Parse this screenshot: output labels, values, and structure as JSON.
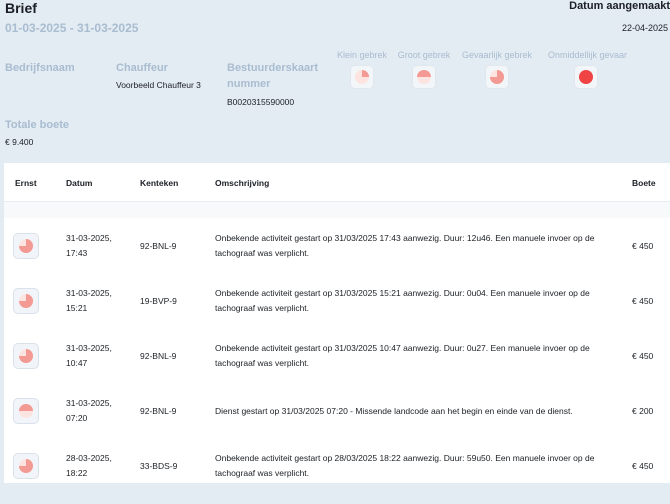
{
  "header": {
    "title": "Brief",
    "period": "01-03-2025 - 31-03-2025",
    "created_label": "Datum aangemaakt",
    "created_date": "22-04-2025"
  },
  "info": {
    "company_label": "Bedrijfsnaam",
    "driver_label": "Chauffeur",
    "driver_value": "Voorbeeld Chauffeur 3",
    "card_label_line1": "Bestuurderskaart",
    "card_label_line2": "nummer",
    "card_value": "B0020315590000",
    "fine_label": "Totale boete",
    "fine_value": "€ 9.400"
  },
  "severity_legend": [
    {
      "label": "Klein gebrek",
      "icon": "pie-quarter-icon"
    },
    {
      "label": "Groot gebrek",
      "icon": "pie-half-icon"
    },
    {
      "label": "Gevaarlijk gebrek",
      "icon": "pie-three-quarter-icon"
    },
    {
      "label": "Onmiddellijk gevaar",
      "icon": "full-circle-icon"
    }
  ],
  "colors": {
    "accent": "#f29a93",
    "danger": "#f04343",
    "muted": "#a9bcd0"
  },
  "table": {
    "headers": {
      "severity": "Ernst",
      "date": "Datum",
      "plate": "Kenteken",
      "description": "Omschrijving",
      "fine": "Boete"
    },
    "rows": [
      {
        "severity": "gevaarlijk",
        "date_line1": "31-03-2025,",
        "date_line2": "17:43",
        "plate": "92-BNL-9",
        "desc_line1": "Onbekende activiteit gestart op 31/03/2025 17:43 aanwezig. Duur: 12u46. Een manuele invoer op de",
        "desc_line2": "tachograaf was verplicht.",
        "fine": "€ 450"
      },
      {
        "severity": "gevaarlijk",
        "date_line1": "31-03-2025,",
        "date_line2": "15:21",
        "plate": "19-BVP-9",
        "desc_line1": "Onbekende activiteit gestart op 31/03/2025 15:21 aanwezig. Duur: 0u04. Een manuele invoer op de",
        "desc_line2": "tachograaf was verplicht.",
        "fine": "€ 450"
      },
      {
        "severity": "gevaarlijk",
        "date_line1": "31-03-2025,",
        "date_line2": "10:47",
        "plate": "92-BNL-9",
        "desc_line1": "Onbekende activiteit gestart op 31/03/2025 10:47 aanwezig. Duur: 0u27. Een manuele invoer op de",
        "desc_line2": "tachograaf was verplicht.",
        "fine": "€ 450"
      },
      {
        "severity": "groot",
        "date_line1": "31-03-2025,",
        "date_line2": "07:20",
        "plate": "92-BNL-9",
        "desc_line1": "Dienst gestart op 31/03/2025 07:20 - Missende landcode aan het begin en einde van de dienst.",
        "desc_line2": "",
        "fine": "€ 200"
      },
      {
        "severity": "gevaarlijk",
        "date_line1": "28-03-2025,",
        "date_line2": "18:22",
        "plate": "33-BDS-9",
        "desc_line1": "Onbekende activiteit gestart op 28/03/2025 18:22 aanwezig. Duur: 59u50. Een manuele invoer op de",
        "desc_line2": "tachograaf was verplicht.",
        "fine": "€ 450"
      }
    ]
  }
}
